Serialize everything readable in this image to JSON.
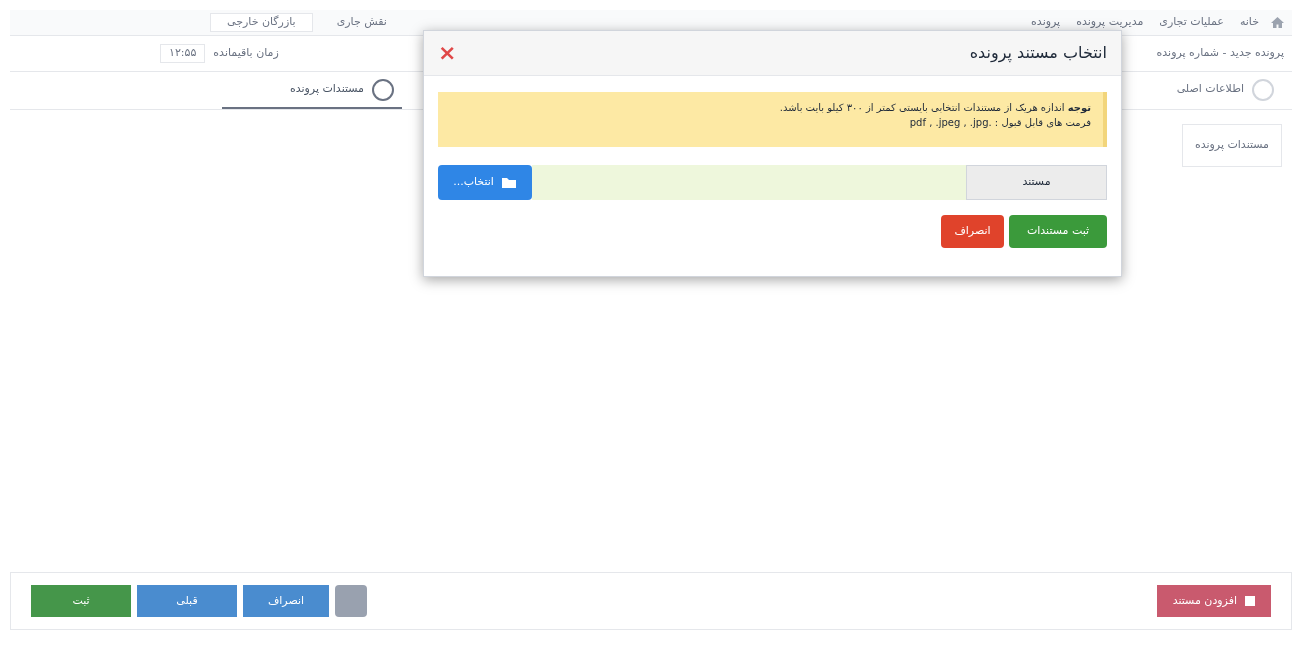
{
  "page": {
    "breadcrumb": [
      "خانه",
      "عملیات تجاری",
      "مدیریت پرونده",
      "پرونده"
    ],
    "role": {
      "label": "نقش جاری",
      "value": "بازرگان خارجی"
    },
    "timer": {
      "label": "زمان باقیمانده",
      "value": "۱۲:۵۵"
    },
    "heading": "پرونده جدید - شماره پرونده",
    "steps": [
      {
        "label": "اطلاعات اصلی",
        "selected": false
      },
      {
        "label": "مستندات پرونده",
        "selected": true
      }
    ],
    "panel_title": "مستندات پرونده",
    "footer": {
      "add_button": "افزودن مستند",
      "actions": [
        "انصراف",
        "قبلی",
        "ثبت"
      ]
    }
  },
  "dialog": {
    "title": "انتخاب مستند پرونده",
    "close": "×",
    "alert": [
      "**توجه** اندازه هریک از مستندات انتخابی بایستی کمتر از ۳۰۰ کیلو بایت باشد.",
      "فرمت های قابل قبول : .pdf , .jpeg , .jpg"
    ],
    "file": {
      "label": "مستند",
      "button": "انتخاب..."
    },
    "buttons": [
      {
        "kind": "primary",
        "label": "ثبت مستندات"
      },
      {
        "kind": "danger",
        "label": "انصراف"
      }
    ]
  }
}
